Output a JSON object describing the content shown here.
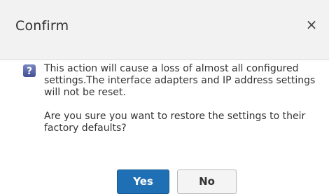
{
  "dialog": {
    "title": "Confirm",
    "close_symbol": "×",
    "message_paragraphs": [
      "This action will cause a loss of almost all configured settings.The interface adapters and IP address settings will not be reset.",
      "Are you sure you want to restore the settings to their factory defaults?"
    ],
    "icon": "question-icon"
  },
  "buttons": {
    "yes_label": "Yes",
    "no_label": "No"
  },
  "colors": {
    "primary_button": "#1f6fb5",
    "icon_bg": "#5b6aa8",
    "title_bar_bg": "#f2f2f2"
  }
}
